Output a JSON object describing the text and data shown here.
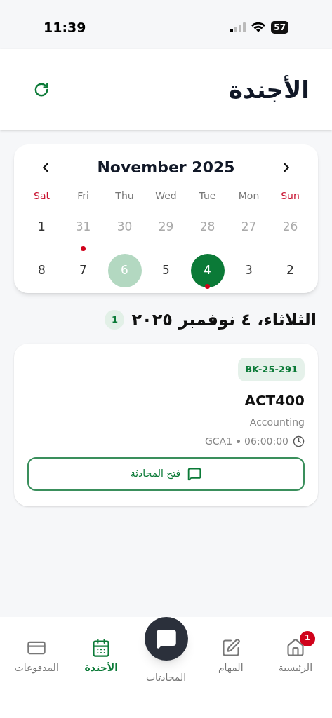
{
  "status_bar": {
    "time": "11:39",
    "battery": "57"
  },
  "header": {
    "title": "الأجندة"
  },
  "calendar": {
    "month": "November 2025",
    "weekdays": [
      {
        "label": "Sun",
        "weekend": true
      },
      {
        "label": "Mon",
        "weekend": false
      },
      {
        "label": "Tue",
        "weekend": false
      },
      {
        "label": "Wed",
        "weekend": false
      },
      {
        "label": "Thu",
        "weekend": false
      },
      {
        "label": "Fri",
        "weekend": false
      },
      {
        "label": "Sat",
        "weekend": true
      }
    ],
    "weeks": [
      [
        {
          "label": "26",
          "outside_month": true,
          "selected": false,
          "today": false,
          "event": false
        },
        {
          "label": "27",
          "outside_month": true,
          "selected": false,
          "today": false,
          "event": false
        },
        {
          "label": "28",
          "outside_month": true,
          "selected": false,
          "today": false,
          "event": false
        },
        {
          "label": "29",
          "outside_month": true,
          "selected": false,
          "today": false,
          "event": false
        },
        {
          "label": "30",
          "outside_month": true,
          "selected": false,
          "today": false,
          "event": false
        },
        {
          "label": "31",
          "outside_month": true,
          "selected": false,
          "today": false,
          "event": true
        },
        {
          "label": "1",
          "outside_month": false,
          "selected": false,
          "today": false,
          "event": false
        }
      ],
      [
        {
          "label": "2",
          "outside_month": false,
          "selected": false,
          "today": false,
          "event": false
        },
        {
          "label": "3",
          "outside_month": false,
          "selected": false,
          "today": false,
          "event": false
        },
        {
          "label": "4",
          "outside_month": false,
          "selected": true,
          "today": false,
          "event": true
        },
        {
          "label": "5",
          "outside_month": false,
          "selected": false,
          "today": false,
          "event": false
        },
        {
          "label": "6",
          "outside_month": false,
          "selected": false,
          "today": true,
          "event": false
        },
        {
          "label": "7",
          "outside_month": false,
          "selected": false,
          "today": false,
          "event": false
        },
        {
          "label": "8",
          "outside_month": false,
          "selected": false,
          "today": false,
          "event": false
        }
      ]
    ]
  },
  "day_heading": {
    "title": "الثلاثاء، ٤ نوفمبر ٢٠٢٥",
    "count": "1"
  },
  "events": [
    {
      "code": "BK-25-291",
      "course": "ACT400",
      "subject": "Accounting",
      "time": "06:00:00",
      "room": "GCA1",
      "action": "فتح المحادثة"
    }
  ],
  "bottom_nav": [
    {
      "label": "الرئيسية",
      "selected": false,
      "kind": "home",
      "badge": "1"
    },
    {
      "label": "المهام",
      "selected": false,
      "kind": "tasks"
    },
    {
      "label": "المحادثات",
      "selected": false,
      "kind": "chat"
    },
    {
      "label": "الأجندة",
      "selected": true,
      "kind": "agenda"
    },
    {
      "label": "المدفوعات",
      "selected": false,
      "kind": "payments"
    }
  ]
}
